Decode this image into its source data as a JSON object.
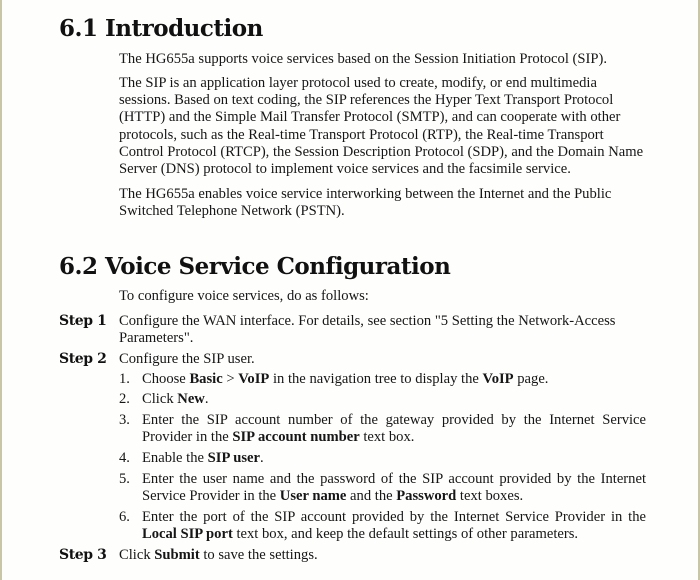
{
  "sections": [
    {
      "title": "6.1 Introduction",
      "paragraphs": [
        "The HG655a supports voice services based on the Session Initiation Protocol (SIP).",
        "The SIP is an application layer protocol used to create, modify, or end multimedia sessions. Based on text coding, the SIP references the Hyper Text Transport Protocol (HTTP) and the Simple Mail Transfer Protocol (SMTP), and can cooperate with other protocols, such as the Real-time Transport Protocol (RTP), the Real-time Transport Control Protocol (RTCP), the Session Description Protocol (SDP), and the Domain Name Server (DNS) protocol to implement voice services and the facsimile service.",
        "The HG655a enables voice service interworking between the Internet and the Public Switched Telephone Network (PSTN)."
      ]
    },
    {
      "title": "6.2 Voice Service Configuration",
      "intro": "To configure voice services, do as follows:",
      "steps": [
        {
          "label": "Step 1",
          "text": "Configure the WAN interface. For details, see section \"5 Setting the Network-Access Parameters\"."
        },
        {
          "label": "Step 2",
          "text": "Configure the SIP user.",
          "substeps": [
            {
              "num": "1.",
              "parts": [
                {
                  "t": "Choose "
                },
                {
                  "t": "Basic",
                  "b": true
                },
                {
                  "t": " > "
                },
                {
                  "t": "VoIP",
                  "b": true
                },
                {
                  "t": " in the navigation tree to display the "
                },
                {
                  "t": "VoIP",
                  "b": true
                },
                {
                  "t": " page."
                }
              ]
            },
            {
              "num": "2.",
              "parts": [
                {
                  "t": "Click "
                },
                {
                  "t": "New",
                  "b": true
                },
                {
                  "t": "."
                }
              ]
            },
            {
              "num": "3.",
              "parts": [
                {
                  "t": "Enter the SIP account number of the gateway provided by the Internet Service Provider in the "
                },
                {
                  "t": "SIP account number",
                  "b": true
                },
                {
                  "t": " text box."
                }
              ]
            },
            {
              "num": "4.",
              "parts": [
                {
                  "t": "Enable the "
                },
                {
                  "t": "SIP user",
                  "b": true
                },
                {
                  "t": "."
                }
              ]
            },
            {
              "num": "5.",
              "parts": [
                {
                  "t": "Enter the user name and the password of the SIP account provided by the Internet Service Provider in the "
                },
                {
                  "t": "User name",
                  "b": true
                },
                {
                  "t": " and the "
                },
                {
                  "t": "Password",
                  "b": true
                },
                {
                  "t": " text boxes."
                }
              ]
            },
            {
              "num": "6.",
              "parts": [
                {
                  "t": "Enter the port of the SIP account provided by the Internet Service Provider in the "
                },
                {
                  "t": "Local SIP port",
                  "b": true
                },
                {
                  "t": " text box, and keep the default settings of other parameters."
                }
              ]
            }
          ]
        },
        {
          "label": "Step 3",
          "parts": [
            {
              "t": "Click "
            },
            {
              "t": "Submit",
              "b": true
            },
            {
              "t": " to save the settings."
            }
          ]
        }
      ]
    }
  ]
}
